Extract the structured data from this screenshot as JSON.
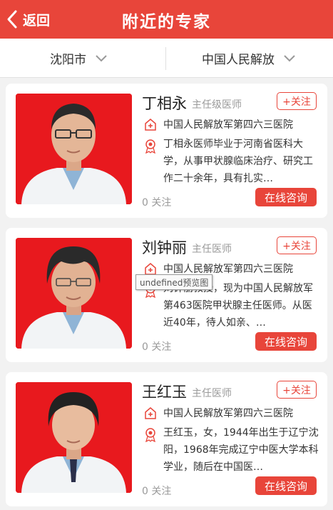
{
  "header": {
    "back_label": "返回",
    "title": "附近的专家"
  },
  "filters": {
    "city": "沈阳市",
    "organization": "中国人民解放"
  },
  "doctors": [
    {
      "name": "丁相永",
      "title": "主任级医师",
      "follow_button": "+关注",
      "hospital": "中国人民解放军第四六三医院",
      "bio": "丁相永医师毕业于河南省医科大学，从事甲状腺临床治疗、研究工作二十余年，具有扎实…",
      "follow_count": "0 关注",
      "consult_button": "在线咨询"
    },
    {
      "name": "刘钟丽",
      "title": "主任医师",
      "follow_button": "+关注",
      "hospital": "中国人民解放军第四六三医院",
      "bio": "刘钟丽教授，现为中国人民解放军第463医院甲状腺主任医师。从医近40年，待人如亲、…",
      "follow_count": "0 关注",
      "consult_button": "在线咨询"
    },
    {
      "name": "王红玉",
      "title": "主任医师",
      "follow_button": "+关注",
      "hospital": "中国人民解放军第四六三医院",
      "bio": "王红玉，女，1944年出生于辽宁沈阳，1968年完成辽宁中医大学本科学业，随后在中国医…",
      "follow_count": "0 关注",
      "consult_button": "在线咨询"
    }
  ],
  "tooltip": "undefined预览图",
  "colors": {
    "brand": "#e8453a",
    "photo_bg": "#e8191e"
  }
}
